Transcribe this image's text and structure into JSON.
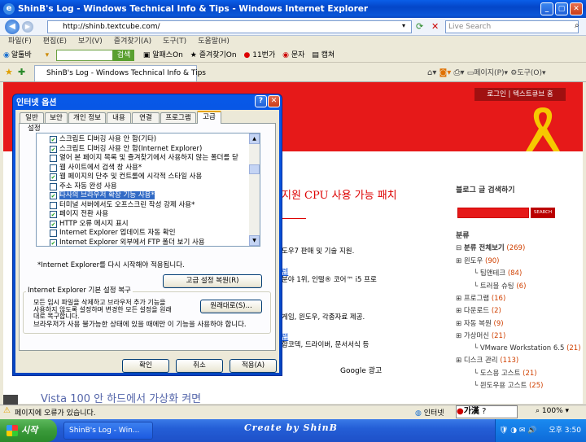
{
  "window": {
    "title": "ShinB's Log - Windows Technical Info & Tips - Windows Internet Explorer"
  },
  "address": {
    "url": "http://shinb.textcube.com/",
    "search_placeholder": "Live Search"
  },
  "menu": [
    "파일(F)",
    "편집(E)",
    "보기(V)",
    "즐겨찾기(A)",
    "도구(T)",
    "도움말(H)"
  ],
  "linkbar": {
    "toolbar_label": "알툴바",
    "search_btn": "검색",
    "items": [
      "알패스On",
      "즐겨찾기On",
      "11번가",
      "문자",
      "캡쳐"
    ]
  },
  "tab": {
    "label": "ShinB's Log - Windows Technical Info & Tips",
    "page_menu": "페이지(P)",
    "tools_menu": "도구(O)"
  },
  "blog": {
    "login": "로그인",
    "textcube": "텍스트큐브 홈",
    "headline": "지원 CPU 사용 가능 패치",
    "search_title": "블로그 글 검색하기",
    "search_btn": "SEARCH",
    "category_title": "분류",
    "category_all": "분류 전체보기",
    "category_all_count": "(269)",
    "categories": [
      {
        "name": "윈도우",
        "count": "(90)",
        "indent": 1
      },
      {
        "name": "팁앤테크",
        "count": "(84)",
        "indent": 2
      },
      {
        "name": "트러블 슈팅",
        "count": "(6)",
        "indent": 2
      },
      {
        "name": "프로그램",
        "count": "(16)",
        "indent": 1
      },
      {
        "name": "다운로드",
        "count": "(2)",
        "indent": 1
      },
      {
        "name": "자동 복원",
        "count": "(9)",
        "indent": 1
      },
      {
        "name": "가상머신",
        "count": "(21)",
        "indent": 1
      },
      {
        "name": "VMware Workstation 6.5",
        "count": "(21)",
        "indent": 2
      },
      {
        "name": "디스크 관리",
        "count": "(113)",
        "indent": 1
      },
      {
        "name": "도스용 고스트",
        "count": "(21)",
        "indent": 2
      },
      {
        "name": "윈도우용 고스트",
        "count": "(25)",
        "indent": 2
      }
    ],
    "body_lines": [
      "도우7 판매 및 기술 지원.",
      "분야 1위, 인텔® 코어™ i5 프로",
      "게임, 윈도우, 각종자료 제공.",
      "합코덱, 드라이버, 문서서식 등"
    ],
    "link1": "렙",
    "link2": "랩",
    "google": "Google 광고",
    "bottom_title": "Vista 100 안 하드에서 가상화 켜면"
  },
  "dialog": {
    "title": "인터넷 옵션",
    "tabs": [
      "일반",
      "보안",
      "개인 정보",
      "내용",
      "연결",
      "프로그램",
      "고급"
    ],
    "settings_label": "설정",
    "items": [
      {
        "label": "스크립트 디버깅 사용 안 함(기타)",
        "checked": true
      },
      {
        "label": "스크립트 디버깅 사용 안 함(Internet Explorer)",
        "checked": true
      },
      {
        "label": "열어 본 페이지 목록 및 즐겨찾기에서 사용하지 않는 폴더를 닫",
        "checked": false
      },
      {
        "label": "웹 사이트에서 검색 창 사용*",
        "checked": false
      },
      {
        "label": "웹 페이지의 단추 및 컨트롤에 시각적 스타일 사용",
        "checked": true
      },
      {
        "label": "주소 자동 완성 사용",
        "checked": false
      },
      {
        "label": "타사의 브라우저 확장 기능 사용*",
        "checked": true,
        "highlight": true
      },
      {
        "label": "터미널 서버에서도 오프스크린 작성 강제 사용*",
        "checked": false
      },
      {
        "label": "페이지 전환 사용",
        "checked": true
      },
      {
        "label": "HTTP 오류 메시지 표시",
        "checked": true
      },
      {
        "label": "Internet Explorer 업데이트 자동 확인",
        "checked": false
      },
      {
        "label": "Internet Explorer 외부에서 FTP 폴더 보기 사용",
        "checked": true
      }
    ],
    "restart_note": "*Internet Explorer를 다시 시작해야 적용됩니다.",
    "restore_adv": "고급 설정 복원(R)",
    "reset_group": "Internet Explorer 기본 설정 복구",
    "reset_desc_1": "모든 임시 파일을 삭제하고 브라우저 추가 기능을",
    "reset_desc_2": "사용하지 않도록 설정하며 변경한 모든 설정을 원래",
    "reset_desc_3": "대로 복구합니다.",
    "reset_btn": "원래대로(S)...",
    "reset_note": "브라우저가 사용 불가능한 상태에 있을 때에만 이 기능을 사용하야 합니다.",
    "ok": "확인",
    "cancel": "취소",
    "apply": "적용(A)"
  },
  "status": {
    "text": "페이지에 오류가 있습니다.",
    "zone": "인터넷",
    "ime": "가漢",
    "zoom": "100%"
  },
  "taskbar": {
    "start": "시작",
    "item": "ShinB's Log - Win...",
    "center": "Create by ShinB",
    "time": "오후 3:50"
  }
}
